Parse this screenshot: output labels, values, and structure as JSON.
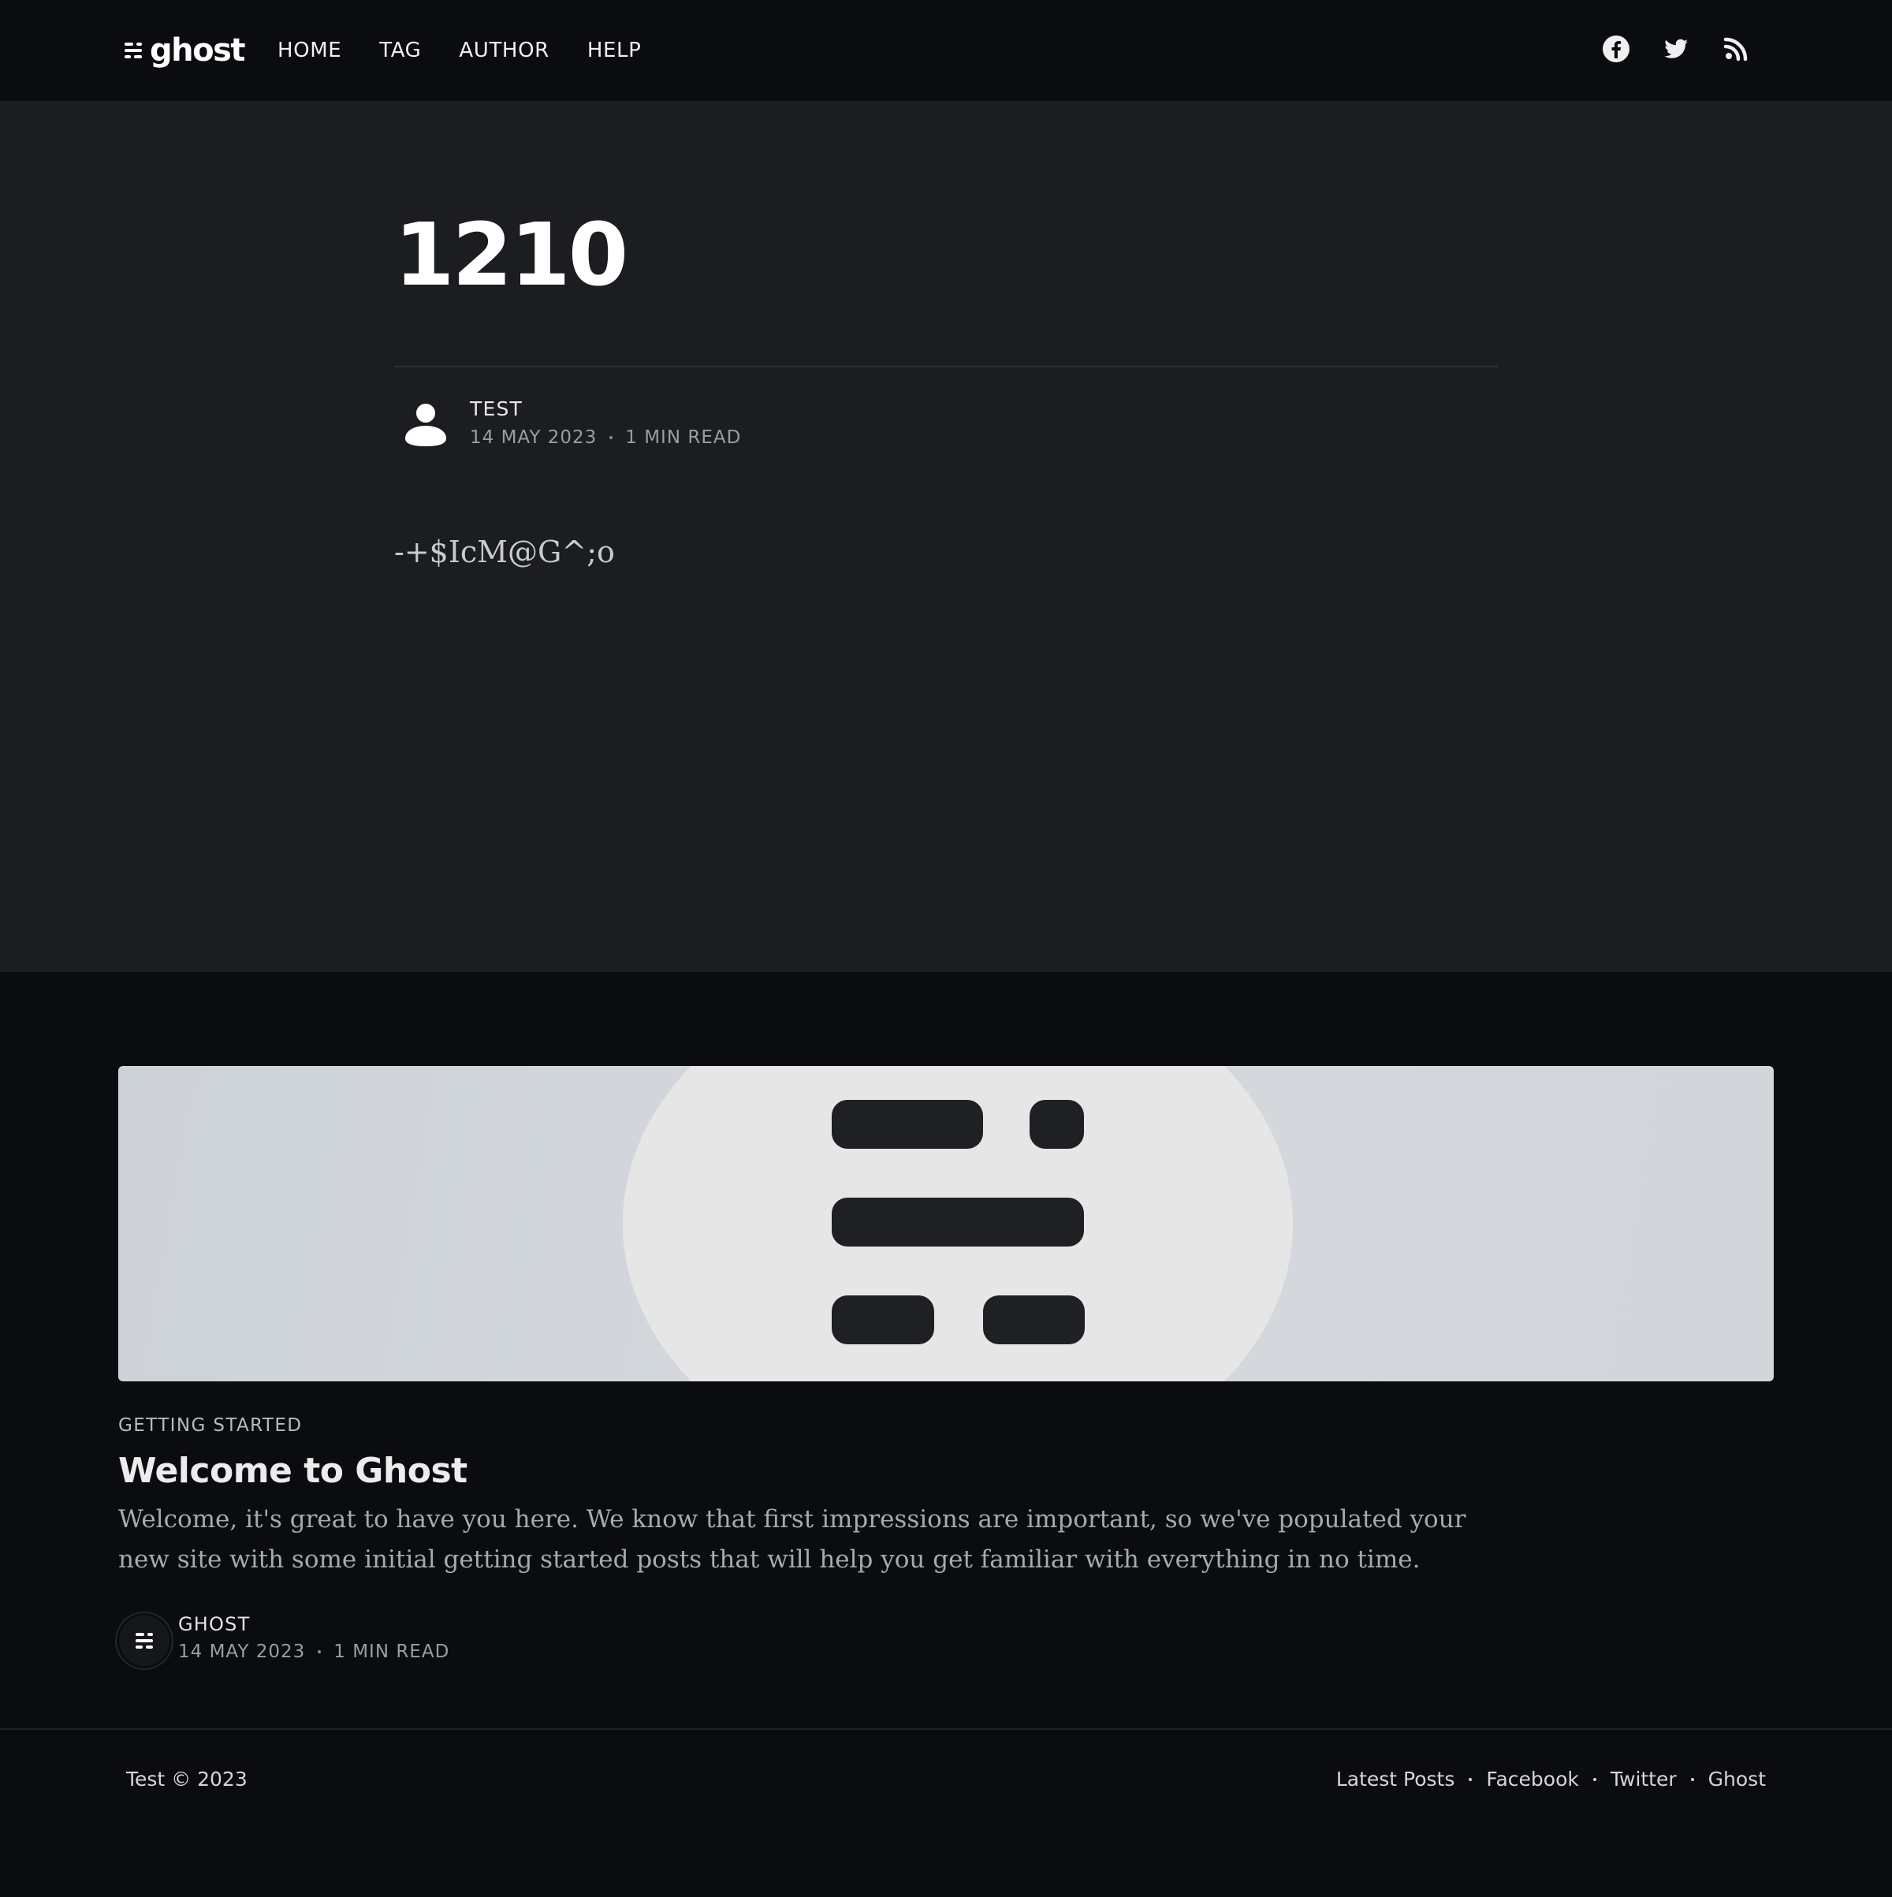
{
  "header": {
    "brand_text": "ghost",
    "brand_icon": "ghost-logo-icon",
    "nav": [
      {
        "label": "HOME"
      },
      {
        "label": "TAG"
      },
      {
        "label": "AUTHOR"
      },
      {
        "label": "HELP"
      }
    ],
    "social": [
      {
        "icon": "facebook-icon"
      },
      {
        "icon": "twitter-icon"
      },
      {
        "icon": "rss-icon"
      }
    ]
  },
  "post": {
    "title": "1210",
    "author": "TEST",
    "date": "14 MAY 2023",
    "reading_time": "1 MIN READ",
    "content": "-+$IcM@G^;o",
    "avatar_icon": "user-avatar-icon"
  },
  "related": {
    "tag": "GETTING STARTED",
    "title": "Welcome to Ghost",
    "excerpt": "Welcome, it's great to have you here. We know that first impressions are important, so we've populated your new site with some initial getting started posts that will help you get familiar with everything in no time.",
    "author": "GHOST",
    "date": "14 MAY 2023",
    "reading_time": "1 MIN READ"
  },
  "footer": {
    "copyright": "Test © 2023",
    "links": [
      {
        "label": "Latest Posts"
      },
      {
        "label": "Facebook"
      },
      {
        "label": "Twitter"
      },
      {
        "label": "Ghost"
      }
    ]
  },
  "colors": {
    "page_bg": "#0b0c0f",
    "post_bg": "#1c1d21",
    "text_primary": "#ffffff",
    "text_muted": "#9a9da3"
  }
}
